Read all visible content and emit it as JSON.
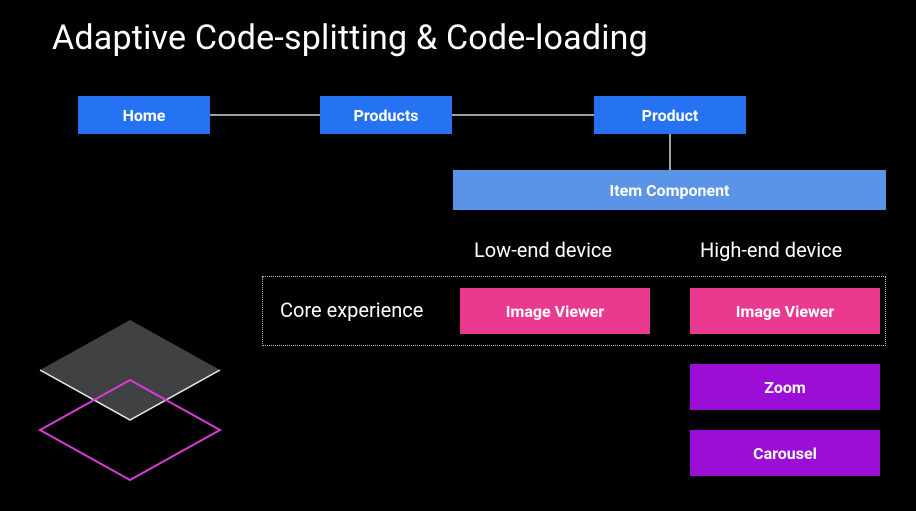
{
  "title": "Adaptive Code-splitting & Code-loading",
  "nav": {
    "home": "Home",
    "products": "Products",
    "product": "Product"
  },
  "item_component": "Item Component",
  "labels": {
    "low_end": "Low-end device",
    "high_end": "High-end device",
    "core": "Core experience"
  },
  "modules": {
    "image_viewer": "Image Viewer",
    "zoom": "Zoom",
    "carousel": "Carousel"
  },
  "colors": {
    "blue": "#2573f2",
    "lightblue": "#5b93e6",
    "pink": "#ea3a8f",
    "purple": "#9c0dd6"
  }
}
